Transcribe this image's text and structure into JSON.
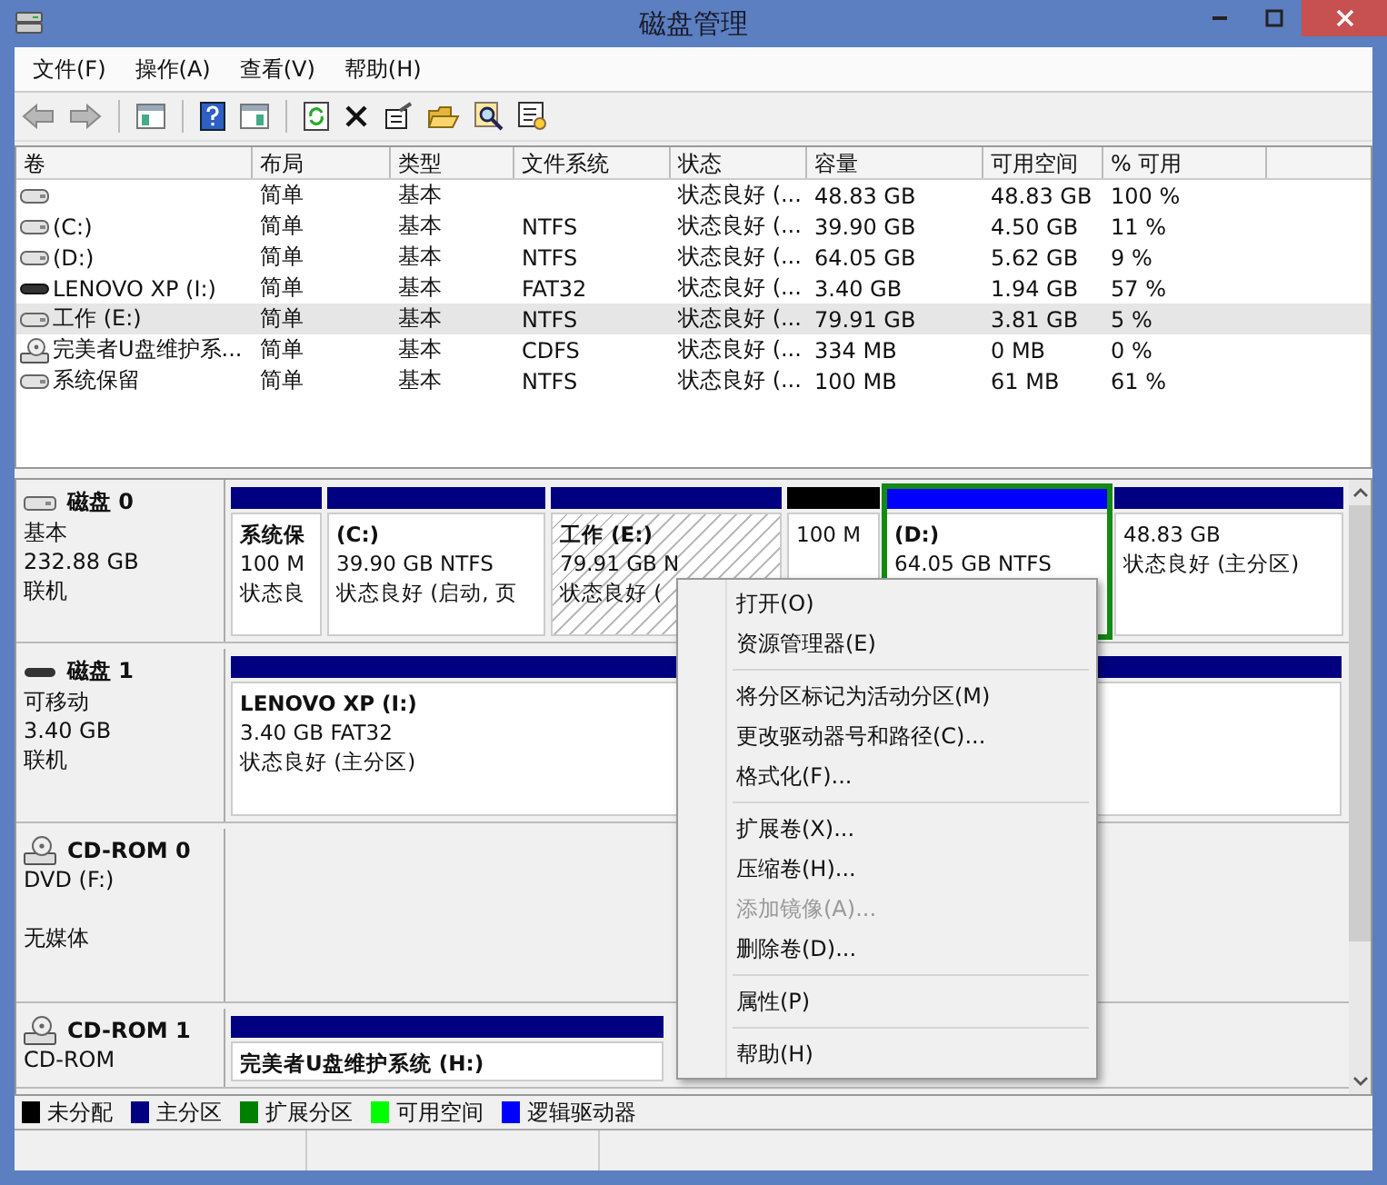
{
  "window": {
    "title": "磁盘管理"
  },
  "menu_bar": [
    "文件(F)",
    "操作(A)",
    "查看(V)",
    "帮助(H)"
  ],
  "volume_table": {
    "columns": [
      "卷",
      "布局",
      "类型",
      "文件系统",
      "状态",
      "容量",
      "可用空间",
      "% 可用"
    ],
    "rows": [
      {
        "kind": "disk",
        "selected": false,
        "layout": "简单",
        "type": "基本",
        "status": "状态良好 (...",
        "capacity": "48.83 GB",
        "free": "48.83 GB",
        "percent_free": "100 %"
      },
      {
        "kind": "disk",
        "selected": false,
        "volume": "(C:)",
        "layout": "简单",
        "type": "基本",
        "filesystem": "NTFS",
        "status": "状态良好 (...",
        "capacity": "39.90 GB",
        "free": "4.50 GB",
        "percent_free": "11 %"
      },
      {
        "kind": "disk",
        "selected": false,
        "volume": "(D:)",
        "layout": "简单",
        "type": "基本",
        "filesystem": "NTFS",
        "status": "状态良好 (...",
        "capacity": "64.05 GB",
        "free": "5.62 GB",
        "percent_free": "9 %"
      },
      {
        "kind": "removable",
        "selected": false,
        "volume": "LENOVO XP (I:)",
        "layout": "简单",
        "type": "基本",
        "filesystem": "FAT32",
        "status": "状态良好 (...",
        "capacity": "3.40 GB",
        "free": "1.94 GB",
        "percent_free": "57 %"
      },
      {
        "kind": "disk",
        "selected": true,
        "volume": "工作 (E:)",
        "layout": "简单",
        "type": "基本",
        "filesystem": "NTFS",
        "status": "状态良好 (...",
        "capacity": "79.91 GB",
        "free": "3.81 GB",
        "percent_free": "5 %"
      },
      {
        "kind": "cdrom",
        "selected": false,
        "volume": "完美者U盘维护系...",
        "layout": "简单",
        "type": "基本",
        "filesystem": "CDFS",
        "status": "状态良好 (...",
        "capacity": "334 MB",
        "free": "0 MB",
        "percent_free": "0 %"
      },
      {
        "kind": "disk",
        "selected": false,
        "volume": "系统保留",
        "layout": "简单",
        "type": "基本",
        "filesystem": "NTFS",
        "status": "状态良好 (...",
        "capacity": "100 MB",
        "free": "61 MB",
        "percent_free": "61 %"
      }
    ]
  },
  "disks": [
    {
      "kind": "disk",
      "name": "磁盘 0",
      "type": "基本",
      "size": "232.88 GB",
      "status": "联机",
      "partitions": [
        {
          "kind": "primary",
          "selected": false,
          "hatched": false,
          "title": "系统保",
          "lines": [
            "100 M",
            "状态良"
          ]
        },
        {
          "kind": "primary",
          "selected": false,
          "hatched": false,
          "title": "(C:)",
          "lines": [
            "39.90 GB NTFS",
            "状态良好 (启动, 页"
          ]
        },
        {
          "kind": "primary",
          "selected": false,
          "hatched": true,
          "title": "工作  (E:)",
          "lines": [
            "79.91 GB N",
            "状态良好 ("
          ]
        },
        {
          "kind": "unallocated",
          "selected": false,
          "hatched": false,
          "lines": [
            "100 M"
          ]
        },
        {
          "kind": "logical",
          "selected": true,
          "hatched": false,
          "title": "(D:)",
          "lines": [
            "64.05 GB NTFS"
          ]
        },
        {
          "kind": "primary",
          "selected": false,
          "hatched": false,
          "lines": [
            "48.83 GB",
            "状态良好 (主分区)"
          ]
        }
      ]
    },
    {
      "kind": "removable",
      "name": "磁盘 1",
      "type": "可移动",
      "size": "3.40 GB",
      "status": "联机",
      "partitions": [
        {
          "kind": "primary",
          "selected": false,
          "hatched": false,
          "title": "LENOVO XP  (I:)",
          "lines": [
            "3.40 GB FAT32",
            "状态良好 (主分区)"
          ]
        }
      ]
    },
    {
      "kind": "cdrom",
      "name": "CD-ROM 0",
      "type": "DVD (F:)",
      "status": "无媒体"
    },
    {
      "kind": "cdrom",
      "name": "CD-ROM 1",
      "type": "CD-ROM",
      "partitions": [
        {
          "kind": "primary",
          "selected": false,
          "hatched": false,
          "title": "完美者U盘维护系统  (H:)"
        }
      ]
    }
  ],
  "legend": [
    {
      "label": "未分配",
      "color": "#000000"
    },
    {
      "label": "主分区",
      "color": "#000080"
    },
    {
      "label": "扩展分区",
      "color": "#008000"
    },
    {
      "label": "可用空间",
      "color": "#00ff00"
    },
    {
      "label": "逻辑驱动器",
      "color": "#0000ff"
    }
  ],
  "context_menu": [
    {
      "kind": "item",
      "label": "打开(O)",
      "disabled": false
    },
    {
      "kind": "item",
      "label": "资源管理器(E)",
      "disabled": false
    },
    {
      "kind": "separator"
    },
    {
      "kind": "item",
      "label": "将分区标记为活动分区(M)",
      "disabled": false
    },
    {
      "kind": "item",
      "label": "更改驱动器号和路径(C)...",
      "disabled": false
    },
    {
      "kind": "item",
      "label": "格式化(F)...",
      "disabled": false
    },
    {
      "kind": "separator"
    },
    {
      "kind": "item",
      "label": "扩展卷(X)...",
      "disabled": false
    },
    {
      "kind": "item",
      "label": "压缩卷(H)...",
      "disabled": false
    },
    {
      "kind": "item",
      "label": "添加镜像(A)...",
      "disabled": true
    },
    {
      "kind": "item",
      "label": "删除卷(D)...",
      "disabled": false
    },
    {
      "kind": "separator"
    },
    {
      "kind": "item",
      "label": "属性(P)",
      "disabled": false
    },
    {
      "kind": "separator"
    },
    {
      "kind": "item",
      "label": "帮助(H)",
      "disabled": false
    }
  ]
}
